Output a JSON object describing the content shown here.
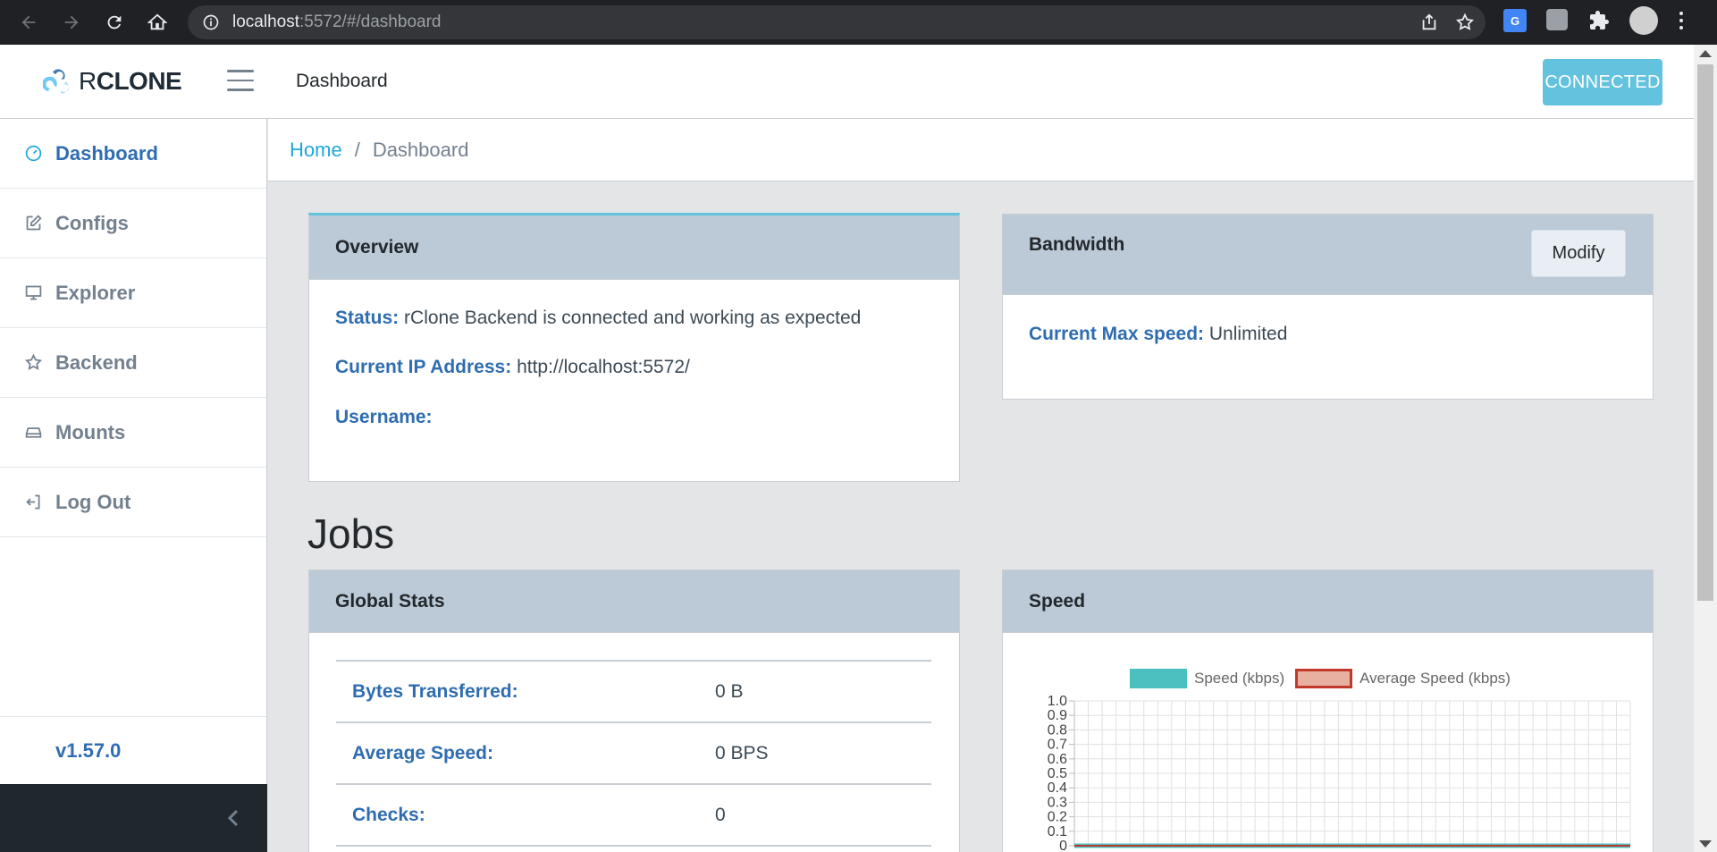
{
  "browser": {
    "url_host": "localhost",
    "url_rest": ":5572/#/dashboard"
  },
  "header": {
    "brand_prefix": "R",
    "brand_suffix": "CLONE",
    "title": "Dashboard",
    "status_button": "CONNECTED",
    "status_color": "#63c2de"
  },
  "sidebar": {
    "items": [
      {
        "label": "Dashboard",
        "icon": "speedometer-icon",
        "active": true
      },
      {
        "label": "Configs",
        "icon": "pencil-square-icon",
        "active": false
      },
      {
        "label": "Explorer",
        "icon": "monitor-icon",
        "active": false
      },
      {
        "label": "Backend",
        "icon": "star-icon",
        "active": false
      },
      {
        "label": "Mounts",
        "icon": "drive-icon",
        "active": false
      },
      {
        "label": "Log Out",
        "icon": "logout-icon",
        "active": false
      }
    ],
    "version": "v1.57.0"
  },
  "breadcrumb": {
    "home": "Home",
    "separator": "/",
    "current": "Dashboard"
  },
  "overview": {
    "title": "Overview",
    "status_label": "Status:",
    "status_value": "rClone Backend is connected and working as expected",
    "ip_label": "Current IP Address:",
    "ip_value": "http://localhost:5572/",
    "username_label": "Username:",
    "username_value": ""
  },
  "bandwidth": {
    "title": "Bandwidth",
    "modify_button": "Modify",
    "max_speed_label": "Current Max speed:",
    "max_speed_value": "Unlimited"
  },
  "jobs": {
    "title": "Jobs"
  },
  "global_stats": {
    "title": "Global Stats",
    "rows": [
      {
        "key": "Bytes Transferred:",
        "value": "0 B"
      },
      {
        "key": "Average Speed:",
        "value": "0 BPS"
      },
      {
        "key": "Checks:",
        "value": "0"
      }
    ]
  },
  "speed": {
    "title": "Speed"
  },
  "chart_data": {
    "type": "line",
    "series": [
      {
        "name": "Speed (kbps)",
        "color": "#4bc0c0",
        "values": [
          0,
          0,
          0,
          0,
          0,
          0,
          0,
          0,
          0,
          0,
          0,
          0,
          0,
          0,
          0,
          0,
          0,
          0,
          0,
          0,
          0,
          0,
          0,
          0,
          0,
          0,
          0,
          0,
          0,
          0,
          0,
          0,
          0,
          0,
          0,
          0,
          0,
          0,
          0,
          0,
          0
        ]
      },
      {
        "name": "Average Speed (kbps)",
        "color": "#c0392b",
        "fill": "#e8b0a0",
        "values": [
          0,
          0,
          0,
          0,
          0,
          0,
          0,
          0,
          0,
          0,
          0,
          0,
          0,
          0,
          0,
          0,
          0,
          0,
          0,
          0,
          0,
          0,
          0,
          0,
          0,
          0,
          0,
          0,
          0,
          0,
          0,
          0,
          0,
          0,
          0,
          0,
          0,
          0,
          0,
          0,
          0
        ]
      }
    ],
    "yticks": [
      "1.0",
      "0.9",
      "0.8",
      "0.7",
      "0.6",
      "0.5",
      "0.4",
      "0.3",
      "0.2",
      "0.1",
      "0"
    ],
    "ylim": [
      0,
      1.0
    ],
    "grid": true,
    "legend_position": "top"
  }
}
